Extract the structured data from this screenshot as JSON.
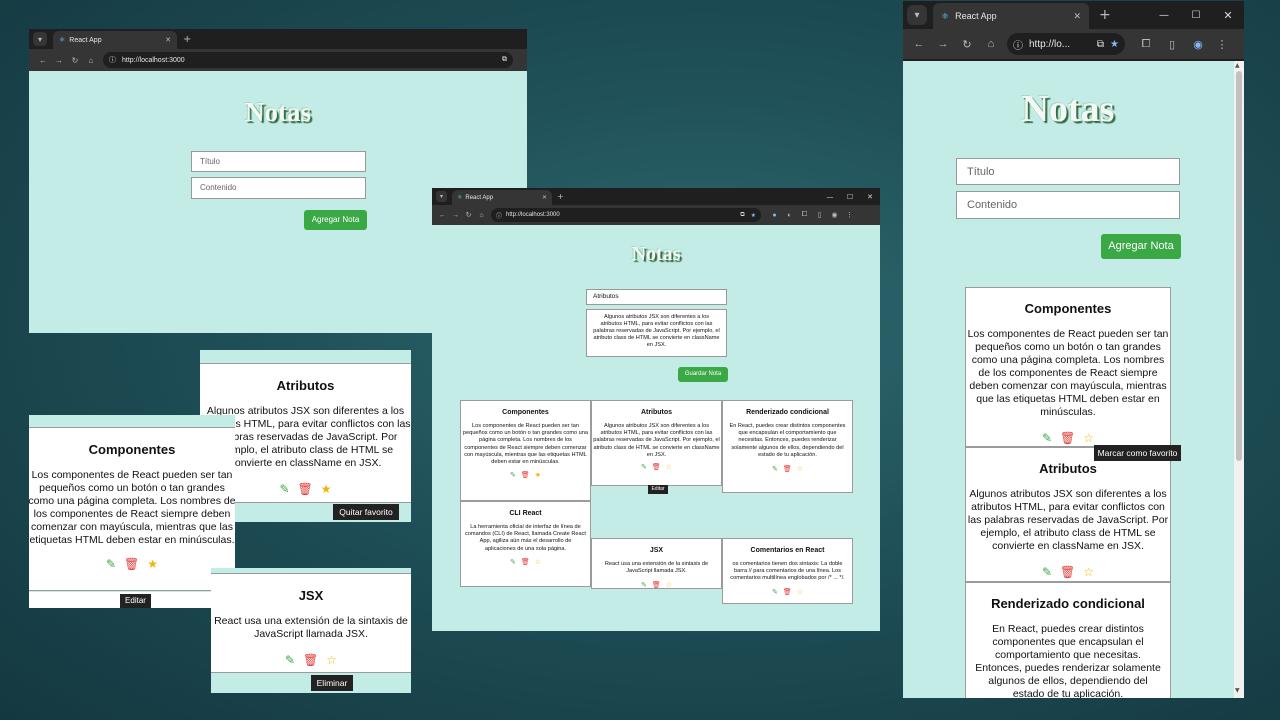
{
  "tab_title": "React App",
  "url": "http://localhost:3000",
  "url_short": "http://lo...",
  "app_title": "Notas",
  "placeholders": {
    "title": "Título",
    "content": "Contenido"
  },
  "buttons": {
    "add": "Agregar Nota",
    "save": "Guardar Nota"
  },
  "edit_form": {
    "title_value": "Atributos",
    "content_value": "Algunos atributos JSX son diferentes a los atributos HTML, para evitar conflictos con las palabras reservadas de JavaScript. Por ejemplo, el atributo class de HTML se convierte en className en JSX."
  },
  "notes": [
    {
      "title": "Componentes",
      "content": "Los componentes de React pueden ser tan pequeños como un botón o tan grandes como una página completa. Los nombres de los componentes de React siempre deben comenzar con mayúscula, mientras que las etiquetas HTML deben estar en minúsculas.",
      "favorite": true
    },
    {
      "title": "Atributos",
      "content": "Algunos atributos JSX son diferentes a los atributos HTML, para evitar conflictos con las palabras reservadas de JavaScript. Por ejemplo, el atributo class de HTML se convierte en className en JSX.",
      "favorite": false
    },
    {
      "title": "Renderizado condicional",
      "content": "En React, puedes crear distintos componentes que encapsulan el comportamiento que necesitas. Entonces, puedes renderizar solamente algunos de ellos, dependiendo del estado de tu aplicación.",
      "favorite": false
    },
    {
      "title": "CLI React",
      "content": "La herramienta oficial de interfaz de línea de comandos (CLI) de React, llamada Create React App, agiliza aún más el desarrollo de aplicaciones de una sola página.",
      "favorite": false
    },
    {
      "title": "JSX",
      "content": "React usa una extensión de la sintaxis de JavaScript llamada JSX.",
      "favorite": false
    },
    {
      "title": "Comentarios en React",
      "content": "os comentarios tienen dos sintaxis: La doble barra // para comentarios de una línea. Los comentarios multilínea englobados por /* ... */.",
      "favorite": false
    }
  ],
  "crop_componentes_content": "Los componentes de React pueden ser tan pequeños como un botón o tan grandes como una página completa. Los nombres de los componentes de React siempre deben comenzar con mayúscula, mientras que las etiquetas HTML deben estar en minúsculas.",
  "tooltips": {
    "quitar_favorito": "Quitar favorito",
    "editar": "Editar",
    "eliminar": "Eliminar",
    "marcar_favorito": "Marcar como favorito"
  },
  "icons": {
    "edit": "edit-icon",
    "delete": "trash-icon",
    "favorite": "star-icon"
  },
  "colors": {
    "page_bg": "#c4ece6",
    "button": "#3aa845",
    "delete": "#e53935",
    "star": "#f5b400"
  }
}
